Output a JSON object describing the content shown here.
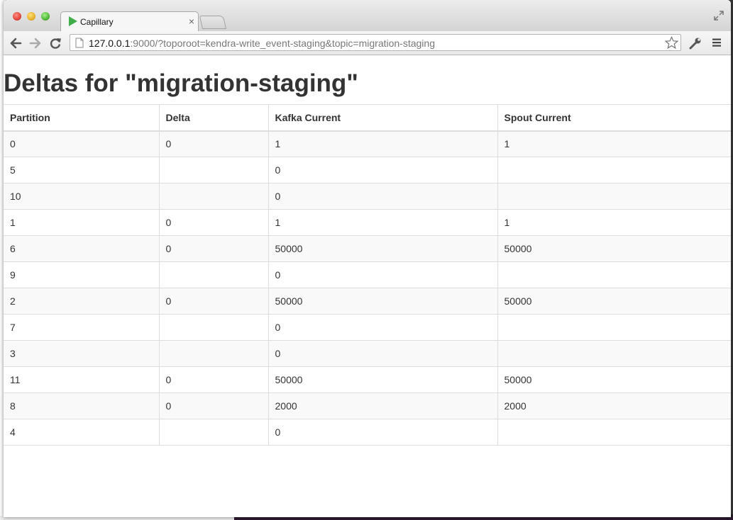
{
  "browser": {
    "tab_title": "Capillary",
    "url_host": "127.0.0.1",
    "url_rest": ":9000/?toporoot=kendra-write_event-staging&topic=migration-staging",
    "tab_close": "×"
  },
  "page": {
    "title": "Deltas for \"migration-staging\""
  },
  "table": {
    "headers": [
      "Partition",
      "Delta",
      "Kafka Current",
      "Spout Current"
    ],
    "rows": [
      [
        "0",
        "0",
        "1",
        "1"
      ],
      [
        "5",
        "",
        "0",
        ""
      ],
      [
        "10",
        "",
        "0",
        ""
      ],
      [
        "1",
        "0",
        "1",
        "1"
      ],
      [
        "6",
        "0",
        "50000",
        "50000"
      ],
      [
        "9",
        "",
        "0",
        ""
      ],
      [
        "2",
        "0",
        "50000",
        "50000"
      ],
      [
        "7",
        "",
        "0",
        ""
      ],
      [
        "3",
        "",
        "0",
        ""
      ],
      [
        "11",
        "0",
        "50000",
        "50000"
      ],
      [
        "8",
        "0",
        "2000",
        "2000"
      ],
      [
        "4",
        "",
        "0",
        ""
      ]
    ]
  },
  "icons": {
    "favicon": "play-triangle-icon",
    "back": "back-arrow-icon",
    "forward": "forward-arrow-icon",
    "reload": "reload-icon",
    "page": "page-icon",
    "star": "star-icon",
    "wrench": "wrench-icon",
    "menu": "menu-icon",
    "fullscreen": "fullscreen-icon"
  },
  "colors": {
    "favicon_green": "#3fae49",
    "text": "#333333",
    "row_stripe": "#f9f9f9",
    "border": "#dddddd"
  }
}
